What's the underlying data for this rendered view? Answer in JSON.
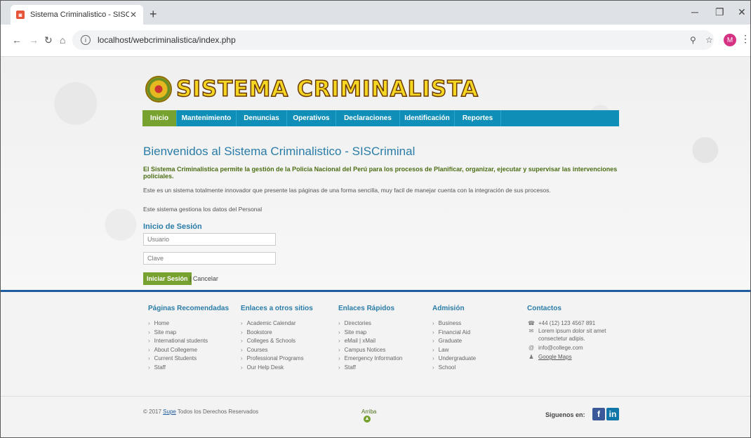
{
  "browser": {
    "tab_title": "Sistema Criminalistico - SISCrimi",
    "url_host": "localhost",
    "url_path": "/webcriminalistica/index.php"
  },
  "site": {
    "logo_text": "SISTEMA CRIMINALISTA",
    "nav": [
      "Inicio",
      "Mantenimiento",
      "Denuncias",
      "Operativos",
      "Declaraciones",
      "Identificación",
      "Reportes"
    ]
  },
  "main": {
    "title": "Bienvenidos al Sistema Criminalistico - SISCriminal",
    "intro": "El Sistema Criminalistica permite la gestión de la Policia Nacional del Perú para los procesos de Planificar, organizar, ejecutar y supervisar las intervenciones policiales.",
    "p1": "Este es un sistema totalmente innovador que presente las páginas de una forma sencilla, muy facil de manejar cuenta con la integración de sus procesos.",
    "p2": "Este sistema gestiona los datos del Personal",
    "login_title": "Inicio de Sesión",
    "user_placeholder": "Usuario",
    "pass_placeholder": "Clave",
    "login_button": "Iniciar Sesión",
    "cancel": "| Cancelar"
  },
  "footer": {
    "columns": [
      {
        "title": "Páginas Recomendadas",
        "items": [
          "Home",
          "Site map",
          "International students",
          "About Collegeme",
          "Current Students",
          "Staff"
        ]
      },
      {
        "title": "Enlaces a otros sitios",
        "items": [
          "Academic Calendar",
          "Bookstore",
          "Colleges & Schools",
          "Courses",
          "Professional Programs",
          "Our Help Desk"
        ]
      },
      {
        "title": "Enlaces Rápidos",
        "items": [
          "Directories",
          "Site map",
          "eMail | xMail",
          "Campus Notices",
          "Emergency Information",
          "Staff"
        ]
      },
      {
        "title": "Admisión",
        "items": [
          "Business",
          "Financial Aid",
          "Graduate",
          "Law",
          "Undergraduate",
          "School"
        ]
      }
    ],
    "contact_title": "Contactos",
    "phone": "+44 (12) 123 4567 891",
    "address1": "Lorem ipsum dolor sit amet",
    "address2": "consectetur adipis.",
    "email": "info@college.com",
    "maps": "Google Maps",
    "copyright_pre": "© 2017",
    "copyright_link": "Supe",
    "copyright_post": "Todos los Derechos Reservados",
    "arriba": "Arriba",
    "follow": "Siguenos en:"
  }
}
